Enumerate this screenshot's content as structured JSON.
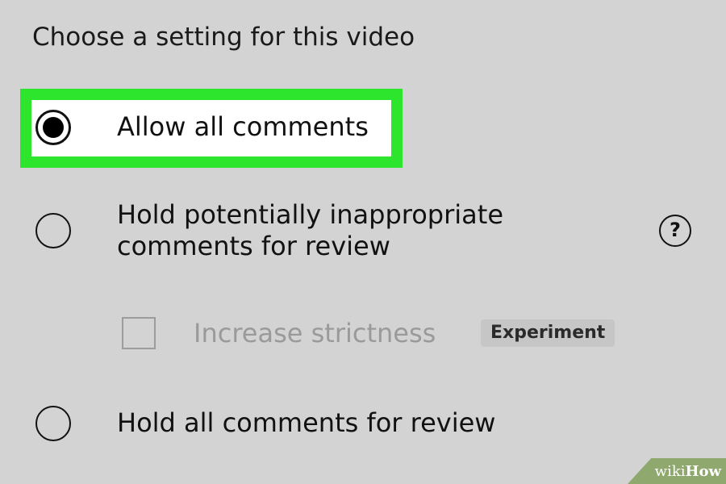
{
  "heading": "Choose a setting for this video",
  "options": [
    {
      "label": "Allow all comments",
      "selected": true
    },
    {
      "label_line1": "Hold potentially inappropriate",
      "label_line2": "comments for review",
      "selected": false
    },
    {
      "label": "Hold all comments for review",
      "selected": false
    }
  ],
  "help_icon_glyph": "?",
  "strictness": {
    "label": "Increase strictness",
    "badge": "Experiment",
    "checked": false
  },
  "watermark": {
    "part1": "wiki",
    "part2": "How"
  },
  "colors": {
    "highlight": "#2ee52e",
    "background": "#d3d3d3"
  }
}
